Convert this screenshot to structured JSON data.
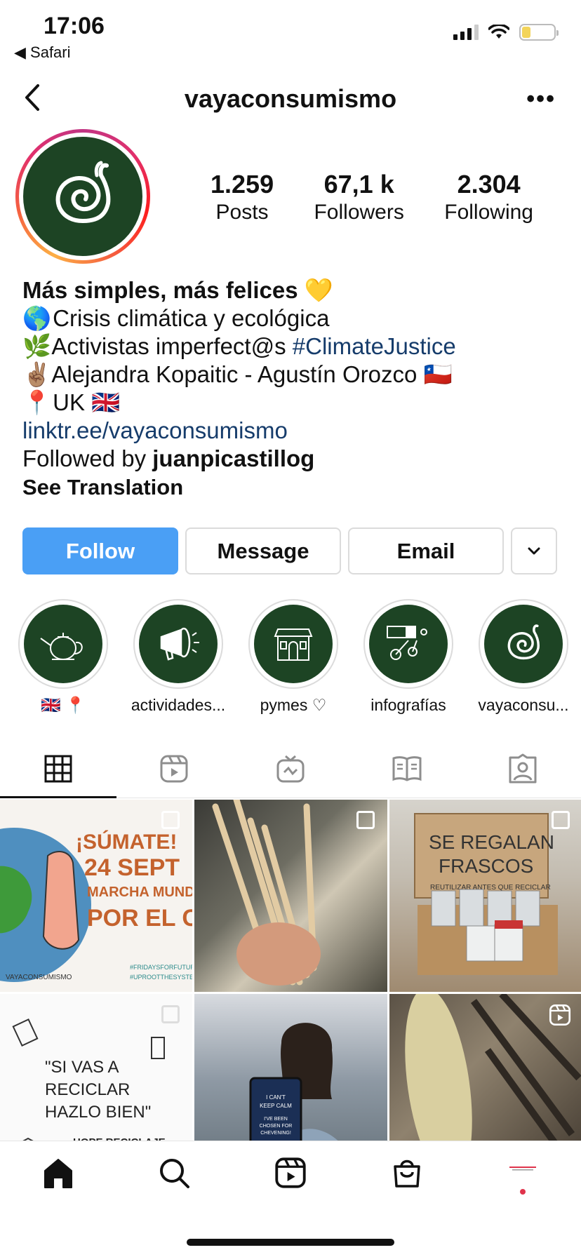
{
  "status_bar": {
    "time": "17:06",
    "back_app": "◀ Safari"
  },
  "header": {
    "username": "vayaconsumismo",
    "more": "•••"
  },
  "stats": [
    {
      "value": "1.259",
      "label": "Posts"
    },
    {
      "value": "67,1 k",
      "label": "Followers"
    },
    {
      "value": "2.304",
      "label": "Following"
    }
  ],
  "bio": {
    "name": "Más simples, más felices",
    "name_emoji": "💛",
    "line1_emoji": "🌎",
    "line1": "Crisis climática y ecológica",
    "line2_emoji": "🌿",
    "line2_text": "Activistas imperfect@s",
    "line2_hashtag": "#ClimateJustice",
    "line3_emoji": "✌🏽",
    "line3_text": "Alejandra Kopaitic - Agustín Orozco",
    "line3_flag": "🇨🇱",
    "line4_emoji": "📍",
    "line4_text": "UK",
    "line4_flag": "🇬🇧",
    "link": "linktr.ee/vayaconsumismo",
    "followed_prefix": "Followed by",
    "followed_user": "juanpicastillog",
    "see_translation": "See Translation"
  },
  "buttons": {
    "follow": "Follow",
    "message": "Message",
    "email": "Email"
  },
  "highlights": [
    {
      "label": "🇬🇧 📍",
      "icon": "teapot-icon"
    },
    {
      "label": "actividades...",
      "icon": "megaphone-icon"
    },
    {
      "label": "pymes ♡",
      "icon": "shop-icon"
    },
    {
      "label": "infografías",
      "icon": "chart-icon"
    },
    {
      "label": "vayaconsu...",
      "icon": "snail-icon"
    }
  ],
  "posts": {
    "p1_line1": "¡SÚMATE!",
    "p1_line2": "24 SEPT",
    "p1_line3": "MARCHA MUNDIAL",
    "p1_line4": "POR EL CLIMA",
    "p1_tag1": "#FRIDAYSFORFUTURE",
    "p1_tag2": "#UPROOTTHESYSTEM",
    "p1_brand": "VAYACONSUMISMO",
    "p3_line1": "SE REGALAN",
    "p3_line2": "FRASCOS",
    "p3_line3": "REUTILIZAR ANTES QUE RECICLAR",
    "p4_line1": "\"SI VAS A",
    "p4_line2": "RECICLAR",
    "p4_line3": "HAZLO BIEN\"",
    "p4_line4": "HOPE RECICLAJE",
    "p5_line1": "I CAN'T",
    "p5_line2": "KEEP CALM",
    "p5_line3": "I'VE BEEN",
    "p5_line4": "CHOSEN FOR",
    "p5_line5": "CHEVENING!"
  },
  "colors": {
    "follow_blue": "#4a9ff5",
    "brand_green": "#1d4424",
    "link_blue": "#163c6b"
  }
}
